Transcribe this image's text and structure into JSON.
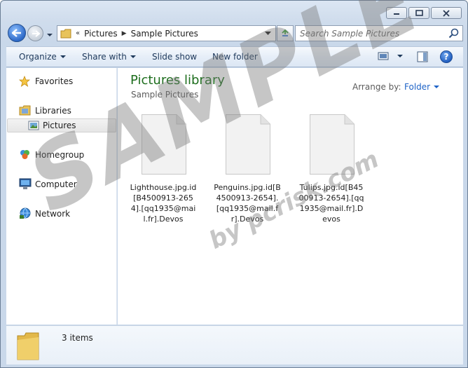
{
  "window": {
    "caption_buttons": [
      "minimize",
      "maximize",
      "close"
    ]
  },
  "navbar": {
    "breadcrumb_prefix": "«",
    "breadcrumbs": [
      "Pictures",
      "Sample Pictures"
    ],
    "search_placeholder": "Search Sample Pictures"
  },
  "commandbar": {
    "organize": "Organize",
    "share_with": "Share with",
    "slide_show": "Slide show",
    "new_folder": "New folder",
    "help": "?"
  },
  "navpane": {
    "items": [
      {
        "label": "Favorites",
        "icon": "star-icon"
      },
      {
        "label": "Libraries",
        "icon": "libraries-icon"
      },
      {
        "label": "Pictures",
        "icon": "pictures-icon",
        "selected": true
      },
      {
        "label": "Homegroup",
        "icon": "homegroup-icon"
      },
      {
        "label": "Computer",
        "icon": "computer-icon"
      },
      {
        "label": "Network",
        "icon": "network-icon"
      }
    ]
  },
  "content": {
    "library_title": "Pictures library",
    "library_subtitle": "Sample Pictures",
    "arrange_label": "Arrange by:",
    "arrange_value": "Folder",
    "files": [
      {
        "name": "Lighthouse.jpg.id[B4500913-2654].[qq1935@mail.fr].Devos"
      },
      {
        "name": "Penguins.jpg.id[B4500913-2654].[qq1935@mail.fr].Devos"
      },
      {
        "name": "Tulips.jpg.id[B4500913-2654].[qq1935@mail.fr].Devos"
      }
    ]
  },
  "details": {
    "item_count": "3 items"
  },
  "watermark": {
    "big": "SAMPLE",
    "small": "by pcrisk.com"
  },
  "colors": {
    "library_title": "#1e6e1e",
    "link_blue": "#1e63c7",
    "command_text": "#1e395b"
  }
}
